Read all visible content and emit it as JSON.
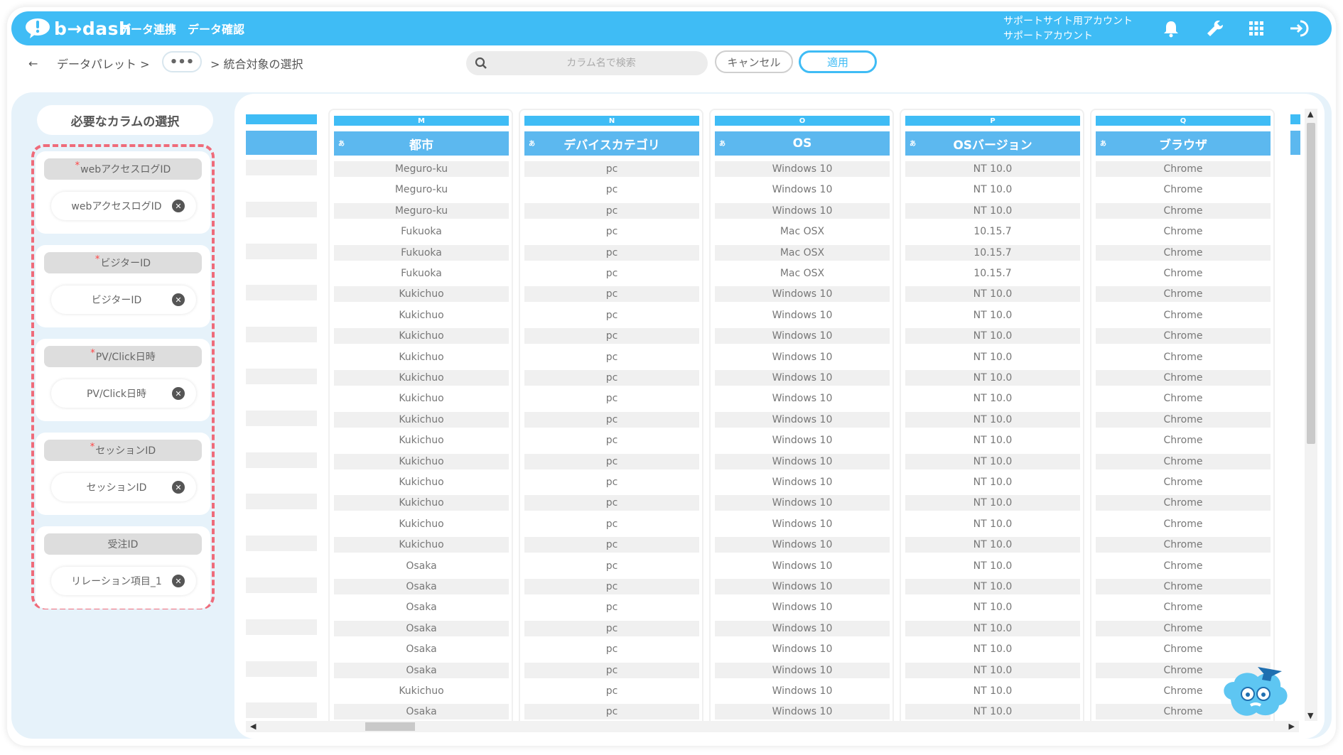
{
  "app": {
    "logo_text": "b→dash",
    "nav": [
      "データ連携",
      "データ確認"
    ],
    "account_line1": "サポートサイト用アカウント",
    "account_line2": "サポートアカウント"
  },
  "breadcrumb": {
    "back": "←",
    "item1": "データパレット >",
    "ellipsis": "•••",
    "current": "> 統合対象の選択"
  },
  "search": {
    "placeholder": "カラム名で検索"
  },
  "buttons": {
    "cancel": "キャンセル",
    "apply": "適用"
  },
  "panel": {
    "title": "必要なカラムの選択",
    "requirements": [
      {
        "label": "webアクセスログID",
        "required": true,
        "value": "webアクセスログID"
      },
      {
        "label": "ビジターID",
        "required": true,
        "value": "ビジターID"
      },
      {
        "label": "PV/Click日時",
        "required": true,
        "value": "PV/Click日時"
      },
      {
        "label": "セッションID",
        "required": true,
        "value": "セッションID"
      },
      {
        "label": "受注ID",
        "required": false,
        "value": "リレーション項目_1"
      }
    ]
  },
  "columns": [
    {
      "letter": "M",
      "type": "あ",
      "name": "都市"
    },
    {
      "letter": "N",
      "type": "あ",
      "name": "デバイスカテゴリ"
    },
    {
      "letter": "O",
      "type": "あ",
      "name": "OS"
    },
    {
      "letter": "P",
      "type": "あ",
      "name": "OSバージョン"
    },
    {
      "letter": "Q",
      "type": "あ",
      "name": "ブラウザ"
    }
  ],
  "rows": [
    [
      "Meguro-ku",
      "pc",
      "Windows 10",
      "NT 10.0",
      "Chrome"
    ],
    [
      "Meguro-ku",
      "pc",
      "Windows 10",
      "NT 10.0",
      "Chrome"
    ],
    [
      "Meguro-ku",
      "pc",
      "Windows 10",
      "NT 10.0",
      "Chrome"
    ],
    [
      "Fukuoka",
      "pc",
      "Mac OSX",
      "10.15.7",
      "Chrome"
    ],
    [
      "Fukuoka",
      "pc",
      "Mac OSX",
      "10.15.7",
      "Chrome"
    ],
    [
      "Fukuoka",
      "pc",
      "Mac OSX",
      "10.15.7",
      "Chrome"
    ],
    [
      "Kukichuo",
      "pc",
      "Windows 10",
      "NT 10.0",
      "Chrome"
    ],
    [
      "Kukichuo",
      "pc",
      "Windows 10",
      "NT 10.0",
      "Chrome"
    ],
    [
      "Kukichuo",
      "pc",
      "Windows 10",
      "NT 10.0",
      "Chrome"
    ],
    [
      "Kukichuo",
      "pc",
      "Windows 10",
      "NT 10.0",
      "Chrome"
    ],
    [
      "Kukichuo",
      "pc",
      "Windows 10",
      "NT 10.0",
      "Chrome"
    ],
    [
      "Kukichuo",
      "pc",
      "Windows 10",
      "NT 10.0",
      "Chrome"
    ],
    [
      "Kukichuo",
      "pc",
      "Windows 10",
      "NT 10.0",
      "Chrome"
    ],
    [
      "Kukichuo",
      "pc",
      "Windows 10",
      "NT 10.0",
      "Chrome"
    ],
    [
      "Kukichuo",
      "pc",
      "Windows 10",
      "NT 10.0",
      "Chrome"
    ],
    [
      "Kukichuo",
      "pc",
      "Windows 10",
      "NT 10.0",
      "Chrome"
    ],
    [
      "Kukichuo",
      "pc",
      "Windows 10",
      "NT 10.0",
      "Chrome"
    ],
    [
      "Kukichuo",
      "pc",
      "Windows 10",
      "NT 10.0",
      "Chrome"
    ],
    [
      "Kukichuo",
      "pc",
      "Windows 10",
      "NT 10.0",
      "Chrome"
    ],
    [
      "Osaka",
      "pc",
      "Windows 10",
      "NT 10.0",
      "Chrome"
    ],
    [
      "Osaka",
      "pc",
      "Windows 10",
      "NT 10.0",
      "Chrome"
    ],
    [
      "Osaka",
      "pc",
      "Windows 10",
      "NT 10.0",
      "Chrome"
    ],
    [
      "Osaka",
      "pc",
      "Windows 10",
      "NT 10.0",
      "Chrome"
    ],
    [
      "Osaka",
      "pc",
      "Windows 10",
      "NT 10.0",
      "Chrome"
    ],
    [
      "Osaka",
      "pc",
      "Windows 10",
      "NT 10.0",
      "Chrome"
    ],
    [
      "Kukichuo",
      "pc",
      "Windows 10",
      "NT 10.0",
      "Chrome"
    ],
    [
      "Osaka",
      "pc",
      "Windows 10",
      "NT 10.0",
      "Chrome"
    ]
  ],
  "icons": [
    "bell-icon",
    "wrench-icon",
    "apps-grid-icon",
    "logout-icon",
    "search-icon",
    "back-arrow-icon",
    "close-icon"
  ],
  "colors": {
    "brand": "#3fbcf5",
    "header": "#5cb8ef",
    "required_outline": "#ef6b7a",
    "workspace": "#e6f2fa"
  }
}
